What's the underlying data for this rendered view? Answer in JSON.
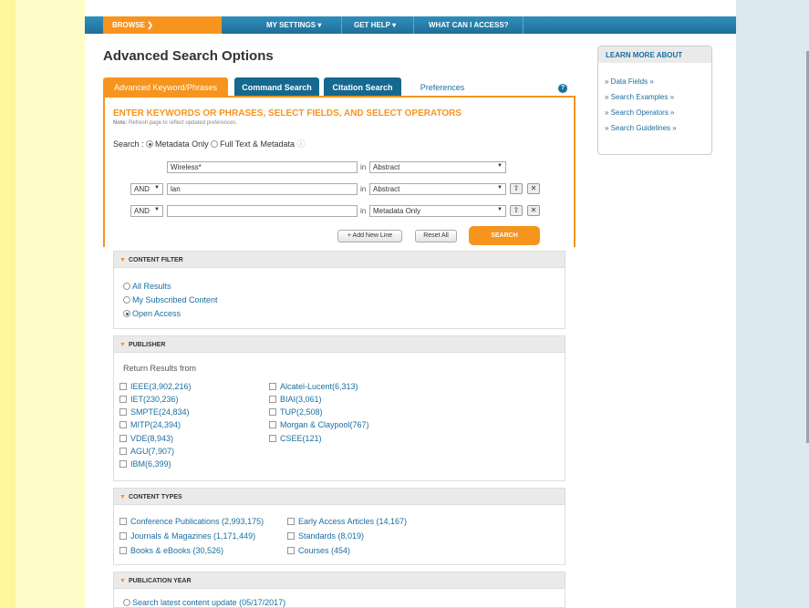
{
  "nav": {
    "browse": "BROWSE",
    "my_settings": "MY SETTINGS",
    "get_help": "GET HELP",
    "what_can_i_access": "WHAT CAN I ACCESS?"
  },
  "page_title": "Advanced Search Options",
  "tabs": {
    "keyword": "Advanced Keyword/Phrases",
    "command": "Command Search",
    "citation": "Citation Search",
    "preferences": "Preferences"
  },
  "instructions": "ENTER KEYWORDS OR PHRASES, SELECT FIELDS, AND SELECT OPERATORS",
  "note_label": "Note:",
  "note_text": "Refresh page to reflect updated preferences.",
  "search_scope": {
    "label": "Search :",
    "metadata_only": "Metadata Only",
    "full_text": "Full Text & Metadata",
    "selected": "Metadata Only"
  },
  "rows": [
    {
      "operator": "",
      "term": "Wireless*",
      "in": "in",
      "field": "Abstract"
    },
    {
      "operator": "AND",
      "term": "lan",
      "in": "in",
      "field": "Abstract"
    },
    {
      "operator": "AND",
      "term": "",
      "in": "in",
      "field": "Metadata Only"
    }
  ],
  "buttons": {
    "add_new_line": "Add New Line",
    "reset_all": "Reset All",
    "search": "SEARCH"
  },
  "content_filter": {
    "title": "CONTENT FILTER",
    "options": [
      "All Results",
      "My Subscribed Content",
      "Open Access"
    ],
    "selected": "Open Access"
  },
  "publisher": {
    "title": "PUBLISHER",
    "return_label": "Return Results from",
    "col1": [
      "IEEE(3,902,216)",
      "IET(230,236)",
      "SMPTE(24,834)",
      "MITP(24,394)",
      "VDE(8,943)",
      "AGU(7,907)",
      "IBM(6,399)"
    ],
    "col2": [
      "Alcatel-Lucent(6,313)",
      "BIAI(3,061)",
      "TUP(2,508)",
      "Morgan & Claypool(767)",
      "CSEE(121)"
    ]
  },
  "content_types": {
    "title": "CONTENT TYPES",
    "col1": [
      "Conference Publications (2,993,175)",
      "Journals & Magazines (1,171,449)",
      "Books & eBooks (30,526)"
    ],
    "col2": [
      "Early Access Articles (14,167)",
      "Standards (8,019)",
      "Courses (454)"
    ]
  },
  "publication_year": {
    "title": "PUBLICATION YEAR",
    "option": "Search latest content update (05/17/2017)"
  },
  "sidebar": {
    "title": "LEARN MORE ABOUT",
    "links": [
      "» Data Fields »",
      "» Search Examples »",
      "» Search Operators »",
      "» Search Guidelines »"
    ]
  },
  "colors": {
    "accent": "#f7941d",
    "nav_blue": "#1f6e99",
    "link": "#1a6fa0"
  }
}
